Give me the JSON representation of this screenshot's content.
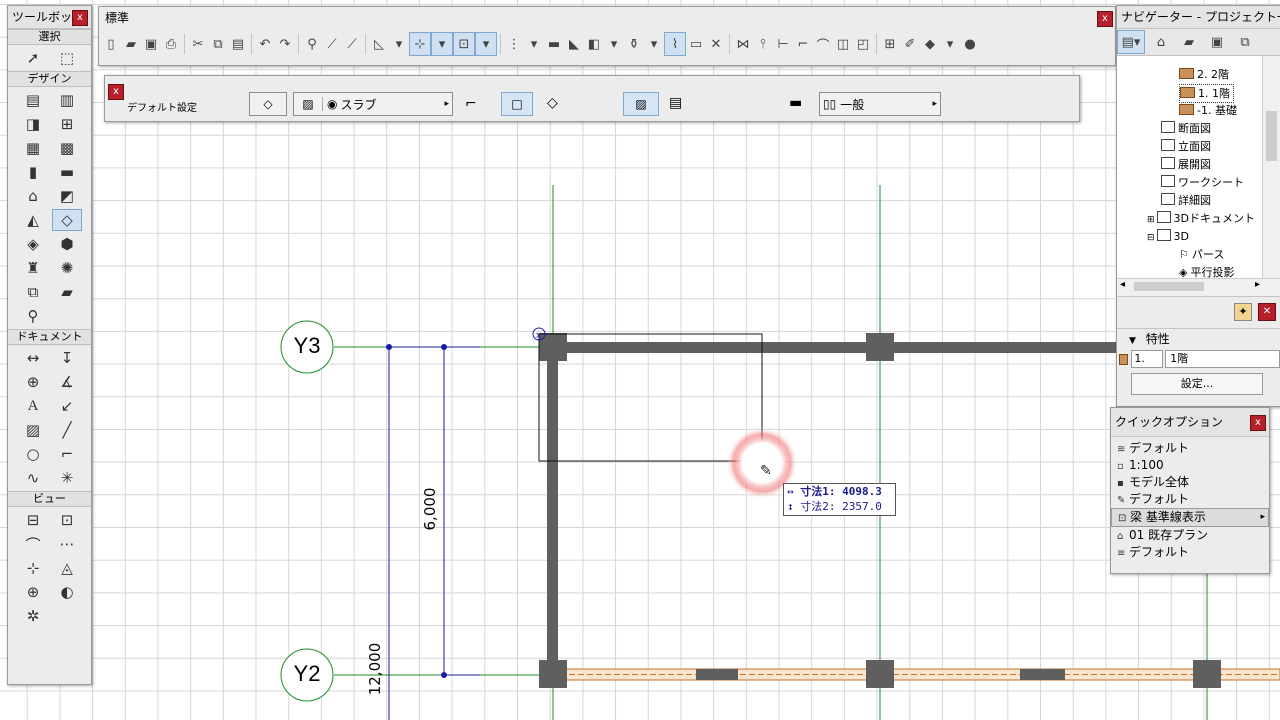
{
  "toolbox": {
    "title": "ツールボッ...",
    "sections": {
      "select": "選択",
      "design": "デザイン",
      "document": "ドキュメント",
      "view": "ビュー"
    }
  },
  "standard_toolbar": {
    "title": "標準"
  },
  "infobox": {
    "default_label": "デフォルト設定",
    "layer_name": "スラブ",
    "structure": "一般"
  },
  "navigator": {
    "title": "ナビゲーター - プロジェクト一覧",
    "tree": [
      "2. 2階",
      "1. 1階",
      "-1. 基礎",
      "断面図",
      "立面図",
      "展開図",
      "ワークシート",
      "詳細図",
      "3Dドキュメント",
      "3D",
      "パース",
      "平行投影"
    ],
    "properties_label": "特性",
    "story_number": "1.",
    "story_name": "1階",
    "settings_button": "設定..."
  },
  "quick_options": {
    "title": "クイックオプション",
    "items": [
      "デフォルト",
      "1:100",
      "モデル全体",
      "デフォルト",
      "梁 基準線表示",
      "01 既存プラン",
      "デフォルト"
    ]
  },
  "drawing": {
    "grid_y3": "Y3",
    "grid_y2": "Y2",
    "dim_6000": "6,000",
    "dim_12000": "12,000"
  },
  "tracker": {
    "dim1_label": "寸法1:",
    "dim1_value": "4098.3",
    "dim2_label": "寸法2:",
    "dim2_value": "2357.0"
  },
  "colors": {
    "wall": "#5f5f5f",
    "grid_line": "#1f8a2a",
    "dim_line": "#1a1aa8",
    "close_button": "#b5202a",
    "highlight": "#cfe0f3"
  }
}
